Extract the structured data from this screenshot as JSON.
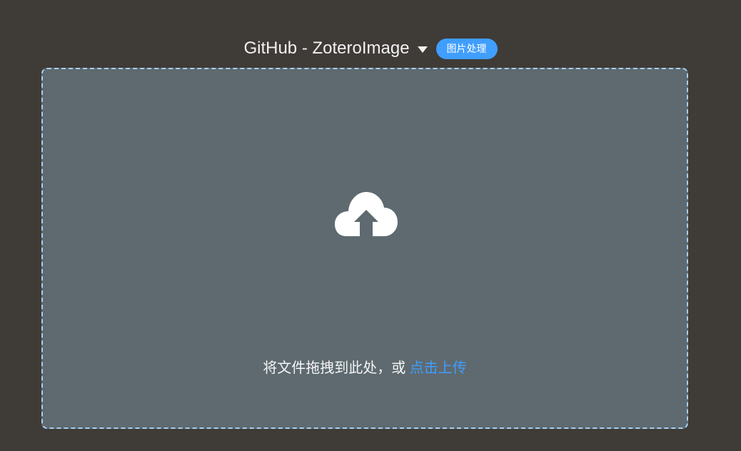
{
  "header": {
    "picbed_name": "GitHub - ZoteroImage",
    "image_process_label": "图片处理"
  },
  "dropzone": {
    "prompt_text": "将文件拖拽到此处，或 ",
    "click_upload_label": "点击上传"
  },
  "icons": {
    "dropdown": "caret-down-icon",
    "upload": "cloud-upload-icon"
  },
  "colors": {
    "background": "#3f3b37",
    "dropzone_fill": "#5e6a70",
    "dropzone_border": "#a7cff2",
    "accent": "#409eff"
  }
}
